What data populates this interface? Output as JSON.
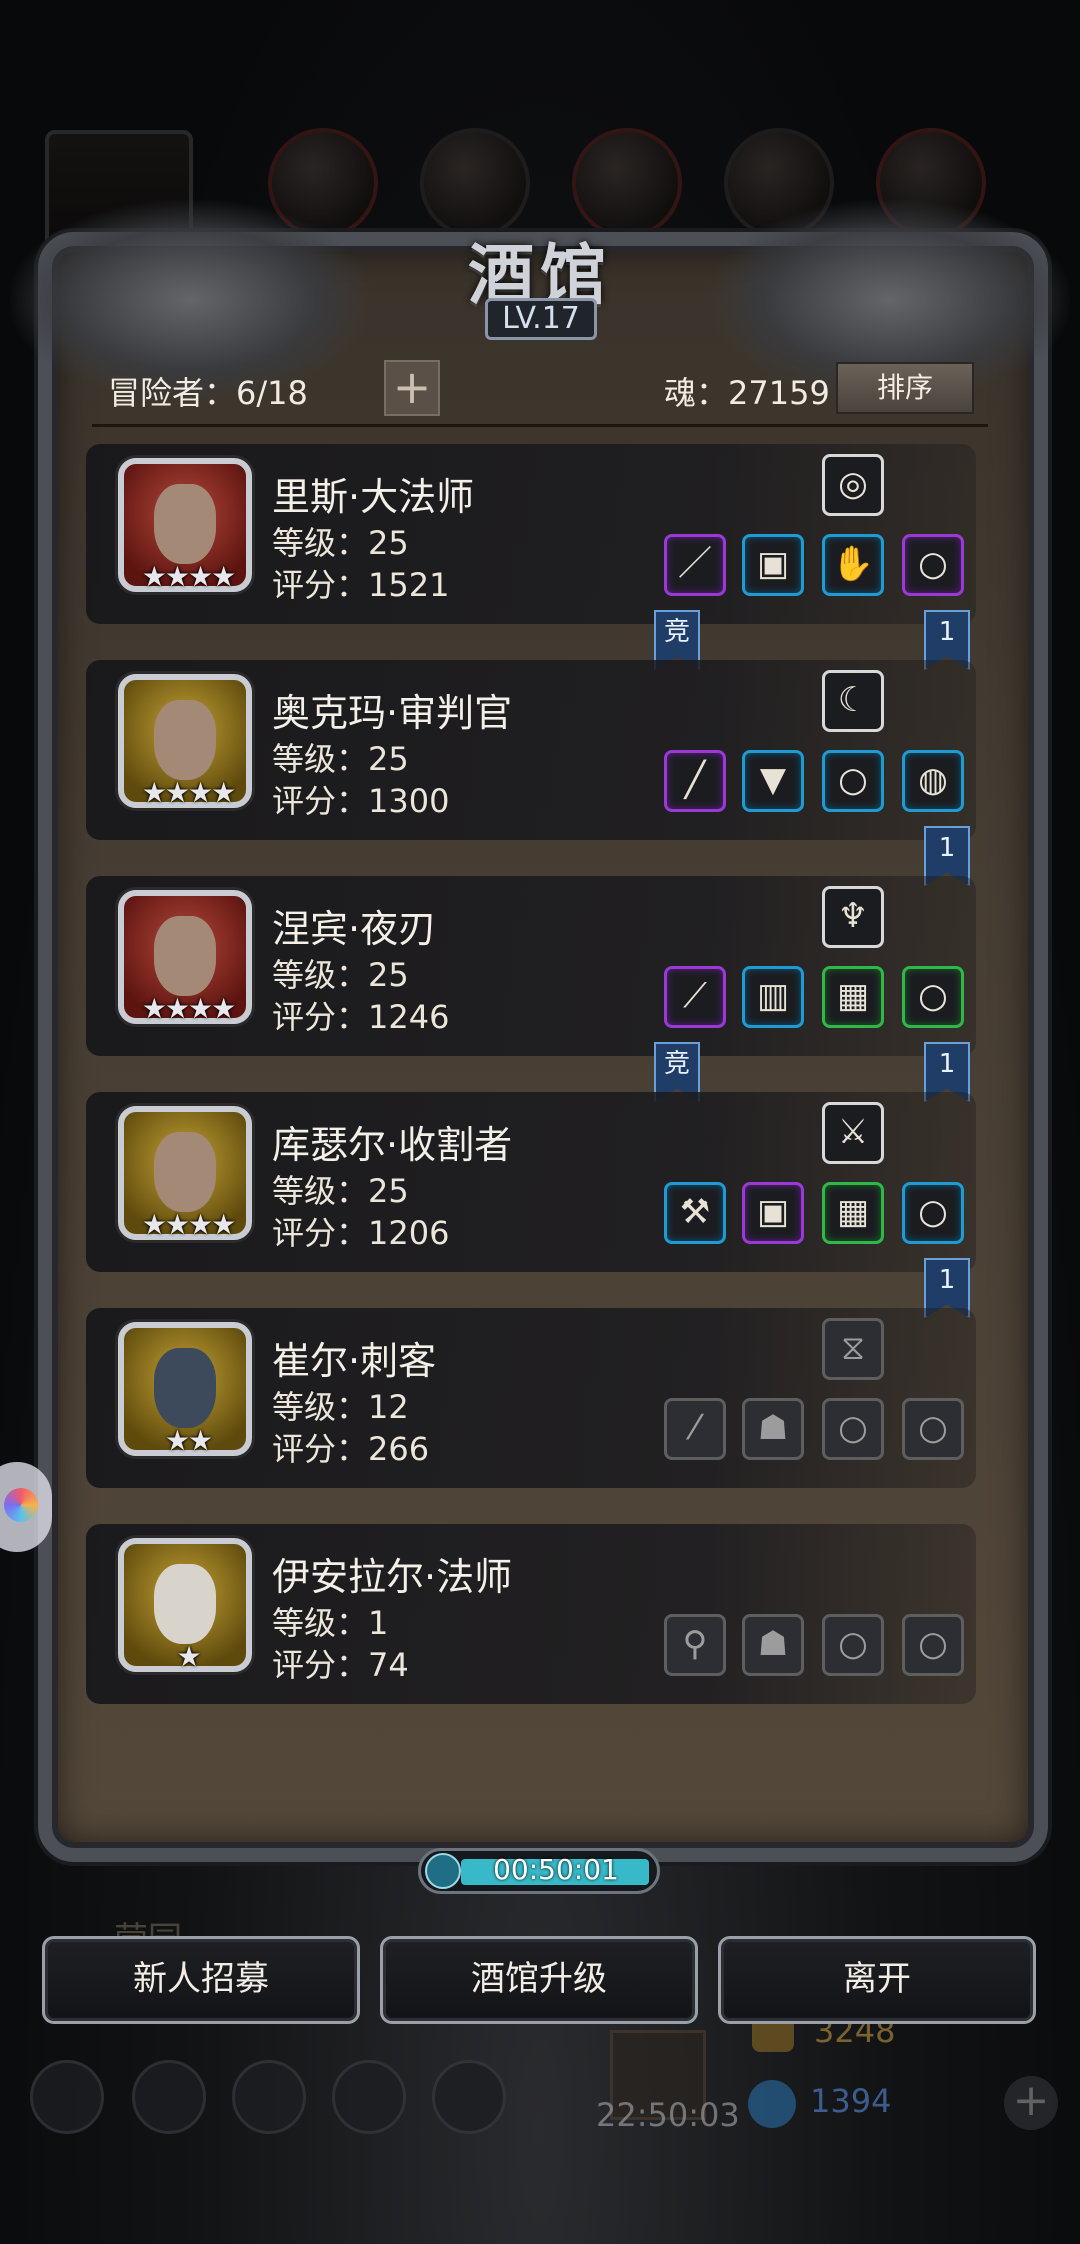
{
  "panel": {
    "title": "酒馆",
    "level": "LV.17",
    "adventurers_label": "冒险者：6/18",
    "soul_label": "魂：27159",
    "add_icon": "plus-icon",
    "sort_label": "排序"
  },
  "heroes": [
    {
      "name": "里斯·大法师",
      "level": "等级：25",
      "score": "评分：1521",
      "stars": "★★★★",
      "frame": "red",
      "top_item": {
        "icon": "ring-icon",
        "glyph": "◎",
        "rarity": "white"
      },
      "items": [
        {
          "glyph": "／",
          "rarity": "purple"
        },
        {
          "glyph": "▣",
          "rarity": "blue"
        },
        {
          "glyph": "✋",
          "rarity": "blue"
        },
        {
          "glyph": "○",
          "rarity": "purple"
        }
      ],
      "ribbon_left": "竞",
      "ribbon_right": "1"
    },
    {
      "name": "奥克玛·审判官",
      "level": "等级：25",
      "score": "评分：1300",
      "stars": "★★★★",
      "frame": "gold",
      "top_item": {
        "icon": "fang-icon",
        "glyph": "☾",
        "rarity": "white"
      },
      "items": [
        {
          "glyph": "╱",
          "rarity": "purple"
        },
        {
          "glyph": "▼",
          "rarity": "blue"
        },
        {
          "glyph": "○",
          "rarity": "blue"
        },
        {
          "glyph": "◍",
          "rarity": "blue"
        }
      ],
      "ribbon_left": "",
      "ribbon_right": "1"
    },
    {
      "name": "涅宾·夜刃",
      "level": "等级：25",
      "score": "评分：1246",
      "stars": "★★★★",
      "frame": "red",
      "top_item": {
        "icon": "amulet-icon",
        "glyph": "♆",
        "rarity": "white"
      },
      "items": [
        {
          "glyph": "⟋",
          "rarity": "purple"
        },
        {
          "glyph": "▥",
          "rarity": "blue"
        },
        {
          "glyph": "▦",
          "rarity": "green"
        },
        {
          "glyph": "○",
          "rarity": "green"
        }
      ],
      "ribbon_left": "竞",
      "ribbon_right": "1"
    },
    {
      "name": "库瑟尔·收割者",
      "level": "等级：25",
      "score": "评分：1206",
      "stars": "★★★★",
      "frame": "gold",
      "top_item": {
        "icon": "bracer-icon",
        "glyph": "⚔",
        "rarity": "white"
      },
      "items": [
        {
          "glyph": "⚒",
          "rarity": "blue"
        },
        {
          "glyph": "▣",
          "rarity": "purple"
        },
        {
          "glyph": "▦",
          "rarity": "green"
        },
        {
          "glyph": "○",
          "rarity": "blue"
        }
      ],
      "ribbon_left": "",
      "ribbon_right": "1"
    },
    {
      "name": "崔尔·刺客",
      "level": "等级：12",
      "score": "评分：266",
      "stars": "★★",
      "frame": "gold",
      "top_item": {
        "icon": "empty-slot-icon",
        "glyph": "⧖",
        "rarity": "empty"
      },
      "items": [
        {
          "glyph": "⁄",
          "rarity": "empty"
        },
        {
          "glyph": "☗",
          "rarity": "empty"
        },
        {
          "glyph": "○",
          "rarity": "empty"
        },
        {
          "glyph": "○",
          "rarity": "empty"
        }
      ],
      "ribbon_left": "",
      "ribbon_right": ""
    },
    {
      "name": "伊安拉尔·法师",
      "level": "等级：1",
      "score": "评分：74",
      "stars": "★",
      "frame": "gold",
      "top_item": null,
      "items": [
        {
          "glyph": "⚲",
          "rarity": "empty"
        },
        {
          "glyph": "☗",
          "rarity": "empty"
        },
        {
          "glyph": "○",
          "rarity": "empty"
        },
        {
          "glyph": "○",
          "rarity": "empty"
        }
      ],
      "ribbon_left": "",
      "ribbon_right": ""
    }
  ],
  "timer": "00:50:01",
  "buttons": {
    "recruit": "新人招募",
    "upgrade": "酒馆升级",
    "leave": "离开"
  },
  "background": {
    "label_partial": "营园",
    "gold": "3248",
    "gems": "1394",
    "clock": "22:50:03"
  },
  "colors": {
    "purple": "#9a3ad6",
    "blue": "#1e9bd3",
    "green": "#2fb74a",
    "timer_fill": "#37b9c9"
  }
}
